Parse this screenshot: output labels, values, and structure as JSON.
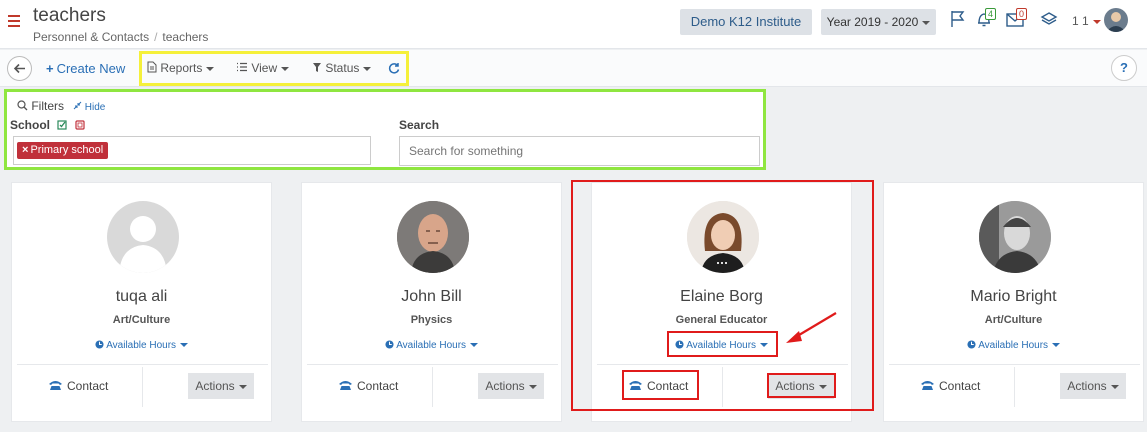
{
  "header": {
    "title": "teachers",
    "breadcrumb": [
      "Personnel & Contacts",
      "teachers"
    ],
    "institute": "Demo K12 Institute",
    "year": "Year 2019 - 2020",
    "notifications_count": "4",
    "messages_count": "0",
    "user_id": "1 1"
  },
  "toolbar": {
    "create_new": "Create New",
    "reports": "Reports",
    "view": "View",
    "status": "Status",
    "help": "?"
  },
  "filters": {
    "title": "Filters",
    "hide": "Hide",
    "school_label": "School",
    "school_tag": "Primary school",
    "search_label": "Search",
    "search_placeholder": "Search for something"
  },
  "cards": [
    {
      "name": "tuqa ali",
      "subject": "Art/Culture",
      "hours": "Available Hours",
      "contact": "Contact",
      "actions": "Actions"
    },
    {
      "name": "John Bill",
      "subject": "Physics",
      "hours": "Available Hours",
      "contact": "Contact",
      "actions": "Actions"
    },
    {
      "name": "Elaine Borg",
      "subject": "General Educator",
      "hours": "Available Hours",
      "contact": "Contact",
      "actions": "Actions"
    },
    {
      "name": "Mario Bright",
      "subject": "Art/Culture",
      "hours": "Available Hours",
      "contact": "Contact",
      "actions": "Actions"
    }
  ],
  "colors": {
    "accent": "#2a6fb5",
    "tag": "#c0303a",
    "highlight_red": "#e01b1b",
    "highlight_yellow": "#f5f03a",
    "highlight_green": "#8fe640"
  }
}
